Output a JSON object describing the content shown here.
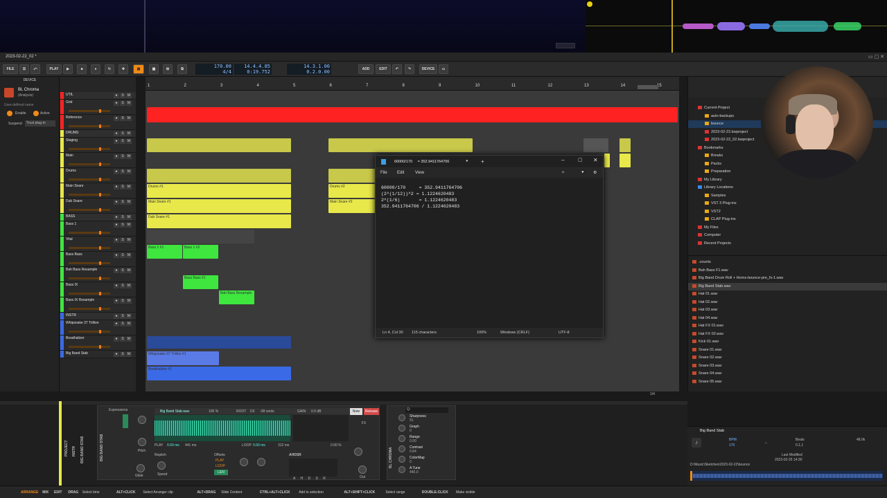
{
  "window": {
    "tab_title": "2023-02-22_02 *"
  },
  "colors": {
    "accent": "#f08a18",
    "drums": "#e8e84a",
    "bass": "#3ee63e",
    "instr": "#3a6ae6",
    "util": "#ff2222",
    "notepad_bg": "#202020"
  },
  "transport": {
    "file": "FILE",
    "play_label": "PLAY",
    "add": "ADD",
    "edit": "EDIT",
    "device": "DEVICE",
    "tempo": "170.00",
    "time_sig": "4/4",
    "position_bars": "14.4.4.85",
    "position_time": "0:19.752",
    "loop_start": "14.3.1.00",
    "loop_len": "0.2.0.00"
  },
  "device_panel": {
    "header": "DEVICE",
    "plugin_name": "BL Chroma",
    "plugin_sub": "(Analysis)",
    "field": "User-defined name",
    "enable": "Enable",
    "active": "Active",
    "suspend_label": "Suspend",
    "suspend_value": "Trust plug-in"
  },
  "tracks": [
    {
      "name": "UTIL",
      "type": "group"
    },
    {
      "name": "Grid",
      "type": "track"
    },
    {
      "name": "Reference",
      "type": "track"
    },
    {
      "name": "DRUMS",
      "type": "group"
    },
    {
      "name": "Staging",
      "type": "track"
    },
    {
      "name": "Main",
      "type": "track"
    },
    {
      "name": "Drums",
      "type": "track"
    },
    {
      "name": "Main Snare",
      "type": "track"
    },
    {
      "name": "Dub Snare",
      "type": "track"
    },
    {
      "name": "BASS",
      "type": "group"
    },
    {
      "name": "Bass 1",
      "type": "track"
    },
    {
      "name": "Vital",
      "type": "track"
    },
    {
      "name": "Bass Bass",
      "type": "track"
    },
    {
      "name": "Bah Bass Resample",
      "type": "track"
    },
    {
      "name": "Bass IX",
      "type": "track"
    },
    {
      "name": "Bass IX Resample",
      "type": "track"
    },
    {
      "name": "INSTR",
      "type": "group"
    },
    {
      "name": "Whipsnake 37 Trillion",
      "type": "track"
    },
    {
      "name": "Breathalizer",
      "type": "track"
    },
    {
      "name": "Big Band Stab",
      "type": "track"
    }
  ],
  "ruler": [
    "1",
    "2",
    "3",
    "4",
    "5",
    "6",
    "7",
    "8",
    "9",
    "10",
    "11",
    "12",
    "13",
    "14",
    "15"
  ],
  "clips": {
    "drums1": "Drums #1",
    "drums2": "Drums #2",
    "snare1": "Main Snare #1",
    "snare2": "Main Snare #2",
    "dub1": "Dub Snare #1",
    "bass1a": "Bass 1 #1",
    "bass1b": "Bass 1 #2",
    "bassbass": "Bass Bass #1",
    "bahbass": "Bah Bass Resample",
    "whip": "Whipsnake 37 Trillion #1",
    "breath": "Breathalizer #1"
  },
  "notepad": {
    "title": "60000/170     = 352.9411764706",
    "menu": [
      "File",
      "Edit",
      "View"
    ],
    "lines": [
      "60000/170     = 352.9411764706",
      "(2^(1/12))^2 = 1.1224620483",
      "2^(1/6)       = 1.1224620483",
      "352.9411764706 / 1.1224620483"
    ],
    "status": {
      "pos": "Ln 4, Col 30",
      "chars": "115 characters",
      "zoom": "100%",
      "eol": "Windows (CRLF)",
      "enc": "UTF-8"
    }
  },
  "browser": {
    "tree": [
      "Current Project",
      "auto-backups",
      "bounce",
      "2023-02-22.bwproject",
      "2023-02-22_02.bwproject",
      "Bookmarks",
      "Breaks",
      "Packs",
      "Preparation",
      "My Library",
      "Library Locations",
      "Samples",
      "VST 3 Plug-ins",
      "VST2",
      "CLAP Plug-ins",
      "My Files",
      "Computer",
      "Recent Projects"
    ],
    "files": [
      ".counts",
      "Bah Bass F1.wav",
      "Big Band Drum Roll + Horns-bounce-pre_fx-1.wav",
      "Big Band Stab.wav",
      "Hat 01.wav",
      "Hat 02.wav",
      "Hat 03.wav",
      "Hat 04.wav",
      "Hat FX 01.wav",
      "Hat FX 02.wav",
      "Kick 01.wav",
      "Snare 01.wav",
      "Snare 02.wav",
      "Snare 03.wav",
      "Snare 04.wav",
      "Snare 05.wav"
    ],
    "selected": "Big Band Stab.wav"
  },
  "preview": {
    "name": "Big Band Stab",
    "bpm_label": "BPM",
    "bpm": "170",
    "beats_label": "Beats",
    "beats": "0.1.1",
    "rate": "48.0k",
    "modified_label": "Last Modified",
    "modified": "2023-02-25 14:30",
    "path": "D:\\Music\\Sketches\\2023-02-22\\bounce"
  },
  "sampler": {
    "expressions": "Expressions",
    "sample": "Big Band Stab.wav",
    "pct": "100 %",
    "root_label": "ROOT",
    "root": "D3",
    "cents": "-38 cents",
    "gain_label": "GAIN",
    "gain": "0.0 dB",
    "note": "Note",
    "release": "Release",
    "play": "PLAY",
    "loop": "LOOP",
    "t1": "0.00 ms",
    "t2": "441 ms",
    "t3": "0.00 ms",
    "t4": "312 ms",
    "t5": "0.00 %",
    "repitch": "Repitch",
    "speed": "Speed",
    "pitch": "Pitch",
    "glide": "Glide",
    "offsets": "Offsets",
    "len": "LEN",
    "ahdsr": "AHDSR",
    "ahdsr_keys": [
      "A",
      "H",
      "D",
      "S",
      "R"
    ],
    "fx": "FX",
    "out": "Out"
  },
  "chroma": {
    "title": "BL CHROMA",
    "search": "Q-",
    "params": [
      {
        "name": "Sharpness",
        "value": "91"
      },
      {
        "name": "Graph",
        "value": "0"
      },
      {
        "name": "Range",
        "value": "0.00"
      },
      {
        "name": "Contrast",
        "value": "0.84"
      },
      {
        "name": "ColorMap",
        "value": "0"
      },
      {
        "name": "A Tune",
        "value": "440.0"
      }
    ]
  },
  "bottom_labels": {
    "project": "PROJECT",
    "instr": "INSTR",
    "track": "BIG BAND STAB"
  },
  "page_counter": "1/4",
  "statusbar": [
    {
      "k": "ARRANGE",
      "v": ""
    },
    {
      "k": "MIX",
      "v": ""
    },
    {
      "k": "EDIT",
      "v": ""
    },
    {
      "k": "DRAG",
      "v": "Select time"
    },
    {
      "k": "ALT+CLICK",
      "v": "Select Arranger clip"
    },
    {
      "k": "ALT+DRAG",
      "v": "Slide Content"
    },
    {
      "k": "CTRL+ALT+CLICK",
      "v": "Add to selection"
    },
    {
      "k": "ALT+SHIFT+CLICK",
      "v": "Select range"
    },
    {
      "k": "DOUBLE-CLICK",
      "v": "Make visible"
    }
  ]
}
